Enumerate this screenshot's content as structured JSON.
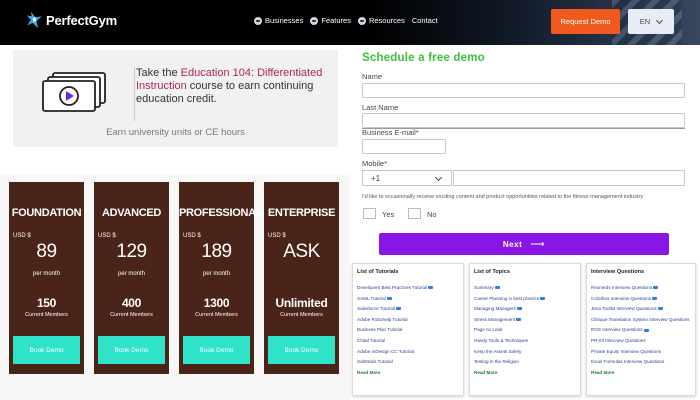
{
  "header": {
    "brand": "PerfectGym",
    "nav": [
      "Businesses",
      "Features",
      "Resources",
      "Contact"
    ],
    "request_demo": "Request Demo",
    "language": "EN"
  },
  "education_ad": {
    "line_prefix": "Take the ",
    "course": "Education 104: Differentiated Instruction",
    "line_suffix": " course to earn continuing education credit.",
    "subtext": "Earn university units or CE hours"
  },
  "pricing": {
    "plans": [
      {
        "name": "FOUNDATION",
        "currency": "USD $",
        "price": "89",
        "period": "per month",
        "members": "150",
        "members_label": "Current Members",
        "button": "Book Demo"
      },
      {
        "name": "ADVANCED",
        "currency": "USD $",
        "price": "129",
        "period": "per month",
        "members": "400",
        "members_label": "Current Members",
        "button": "Book Demo"
      },
      {
        "name": "PROFESSIONAL",
        "currency": "USD $",
        "price": "189",
        "period": "per month",
        "members": "1300",
        "members_label": "Current Members",
        "button": "Book Demo"
      },
      {
        "name": "ENTERPRISE",
        "currency": "USD $",
        "price": "ASK",
        "period": "",
        "members": "Unlimited",
        "members_label": "Current Members",
        "button": "Book Demo"
      }
    ]
  },
  "demo_form": {
    "title": "Schedule a free demo",
    "name_label": "Name",
    "last_name_label": "Last Name",
    "email_label": "Business E-mail*",
    "mobile_label": "Mobile*",
    "country_code": "+1",
    "consent": "I'd like to occasionally receive exciting content and product opportunities related to the fitness management industry",
    "yes_label": "Yes",
    "no_label": "No",
    "next_button": "Next",
    "next_arrow": "⟶"
  },
  "link_lists": [
    {
      "title": "List of Tutorials",
      "items": [
        "Developers Best Practices Tutorial",
        "SAML Tutorial",
        "Salesforce Tutorial",
        "Adobe Robohelp Tutorial",
        "Business Plan Tutorial",
        "Chital Tutorial",
        "Adobe InDesign CC Tutorial",
        "SaltStack Tutorial"
      ],
      "read_more": "Read More"
    },
    {
      "title": "List of Topics",
      "items": [
        "Summary",
        "Career Planning in best practice",
        "Managing Managers",
        "Stress Management",
        "Page no Look",
        "Handy Tools & Techniques",
        "Keep the Assets Safely",
        "Testing in the Religion"
      ],
      "read_more": "Read More"
    },
    {
      "title": "Interview Questions",
      "items": [
        "Rexnerds Interview Questions",
        "Colorbus Interview Questions",
        "Jena Toolkit Interview Questions",
        "Clinique Translation System Interview Questions",
        "ROS Interview Questions",
        "PR-03 Interview Questions",
        "Private Equity Interview Questions",
        "Excel Formulas Interview Questions"
      ],
      "read_more": "Read More"
    }
  ],
  "colors": {
    "brand_orange": "#f05a1e",
    "plan_card": "#4a2419",
    "plan_button": "#2fe3c9",
    "form_title": "#3cc13c",
    "next_button": "#8a16e6",
    "edu_highlight": "#a8285e"
  }
}
